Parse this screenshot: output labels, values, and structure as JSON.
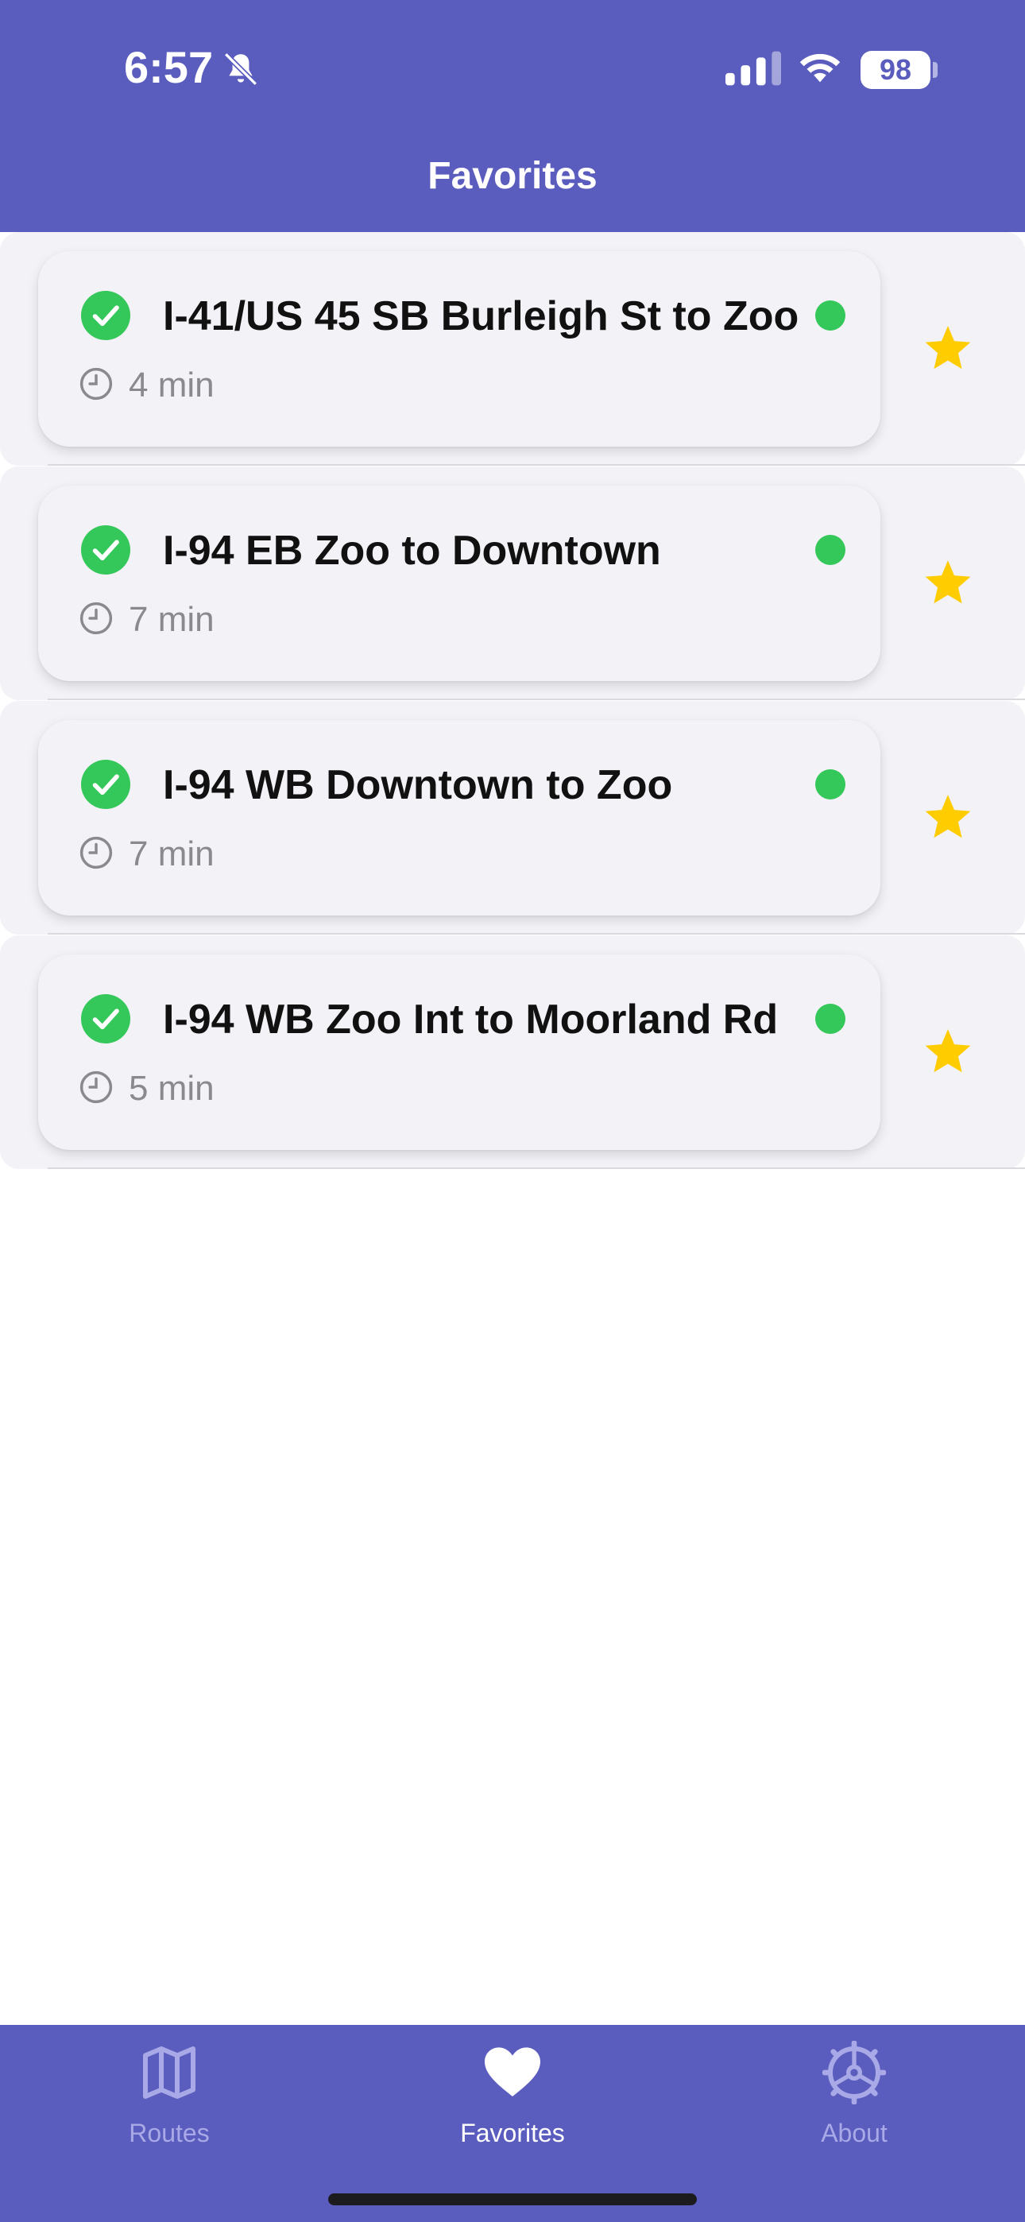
{
  "status_bar": {
    "time": "6:57",
    "battery": "98",
    "icons": [
      "bell-slash-icon",
      "cellular-signal-icon",
      "wifi-icon",
      "battery-icon"
    ]
  },
  "header": {
    "title": "Favorites"
  },
  "favorites": [
    {
      "name": "I-41/US 45 SB Burleigh St to Zoo",
      "time": "4 min",
      "status": "ok",
      "favorited": true
    },
    {
      "name": "I-94 EB Zoo to Downtown",
      "time": "7 min",
      "status": "ok",
      "favorited": true
    },
    {
      "name": "I-94 WB Downtown to Zoo",
      "time": "7 min",
      "status": "ok",
      "favorited": true
    },
    {
      "name": "I-94 WB Zoo Int to Moorland Rd",
      "time": "5 min",
      "status": "ok",
      "favorited": true
    }
  ],
  "tab_bar": {
    "tabs": [
      {
        "label": "Routes",
        "icon": "map-icon",
        "active": false
      },
      {
        "label": "Favorites",
        "icon": "heart-icon",
        "active": true
      },
      {
        "label": "About",
        "icon": "steering-wheel-icon",
        "active": false
      }
    ]
  },
  "colors": {
    "brand": "#5A5CBE",
    "status_green": "#34C759",
    "star_yellow": "#FFCC00",
    "secondary_text": "#8A8A8E",
    "inactive_tab": "#A8A9E6",
    "active_tab": "#FFFFFF"
  }
}
